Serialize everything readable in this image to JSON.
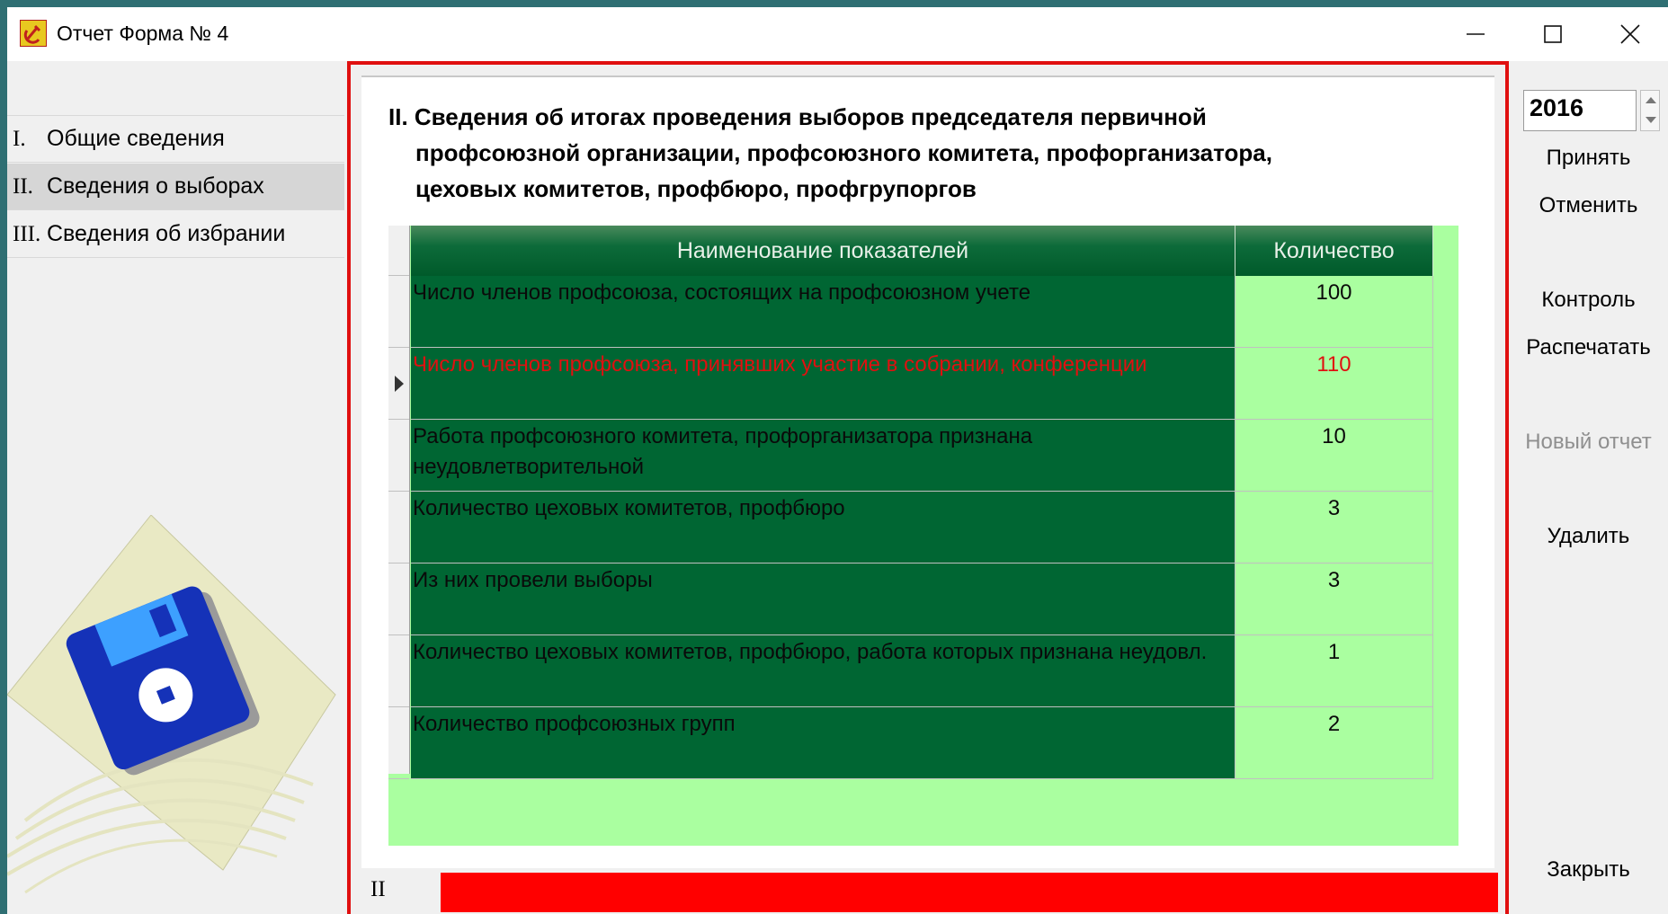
{
  "window": {
    "title": "Отчет Форма № 4"
  },
  "sidebar": {
    "items": [
      {
        "num": "I.",
        "label": "Общие сведения"
      },
      {
        "num": "II.",
        "label": "Сведения о выборах"
      },
      {
        "num": "III.",
        "label": "Сведения об избрании"
      }
    ],
    "active_index": 1
  },
  "section": {
    "title_line1": "II. Сведения об итогах проведения выборов председателя первичной",
    "title_line2": "профсоюзной организации, профсоюзного комитета, профорганизатора,",
    "title_line3": "цеховых комитетов, профбюро, профгрупоргов"
  },
  "table": {
    "headers": [
      "Наименование показателей",
      "Количество"
    ],
    "rows": [
      {
        "name": "Число членов профсоюза, состоящих на профсоюзном учете",
        "qty": "100"
      },
      {
        "name": "Число членов профсоюза, принявших участие в собрании, конференции",
        "qty": "110"
      },
      {
        "name": "Работа профсоюзного комитета, профорганизатора признана неудовлетворительной",
        "qty": "10"
      },
      {
        "name": "Количество цеховых комитетов, профбюро",
        "qty": "3"
      },
      {
        "name": "Из них провели выборы",
        "qty": "3"
      },
      {
        "name": "Количество цеховых комитетов, профбюро, работа которых признана неудовл.",
        "qty": "1"
      },
      {
        "name": "Количество профсоюзных групп",
        "qty": "2"
      }
    ],
    "current_row": 1
  },
  "status": {
    "label": "II"
  },
  "right_panel": {
    "year": "2016",
    "accept": "Принять",
    "cancel": "Отменить",
    "control": "Контроль",
    "print": "Распечатать",
    "new_report": "Новый отчет",
    "delete": "Удалить",
    "close": "Закрыть"
  },
  "colors": {
    "frame_border": "#e01010",
    "name_cell": "#006633",
    "qty_cell": "#aaffa0",
    "error_text": "#e01010",
    "status_red": "#ff0000"
  },
  "icons": [
    "app-hammer-sickle-icon",
    "minimize-icon",
    "maximize-icon",
    "close-icon",
    "floppy-disk-clipart",
    "row-pointer-icon"
  ]
}
